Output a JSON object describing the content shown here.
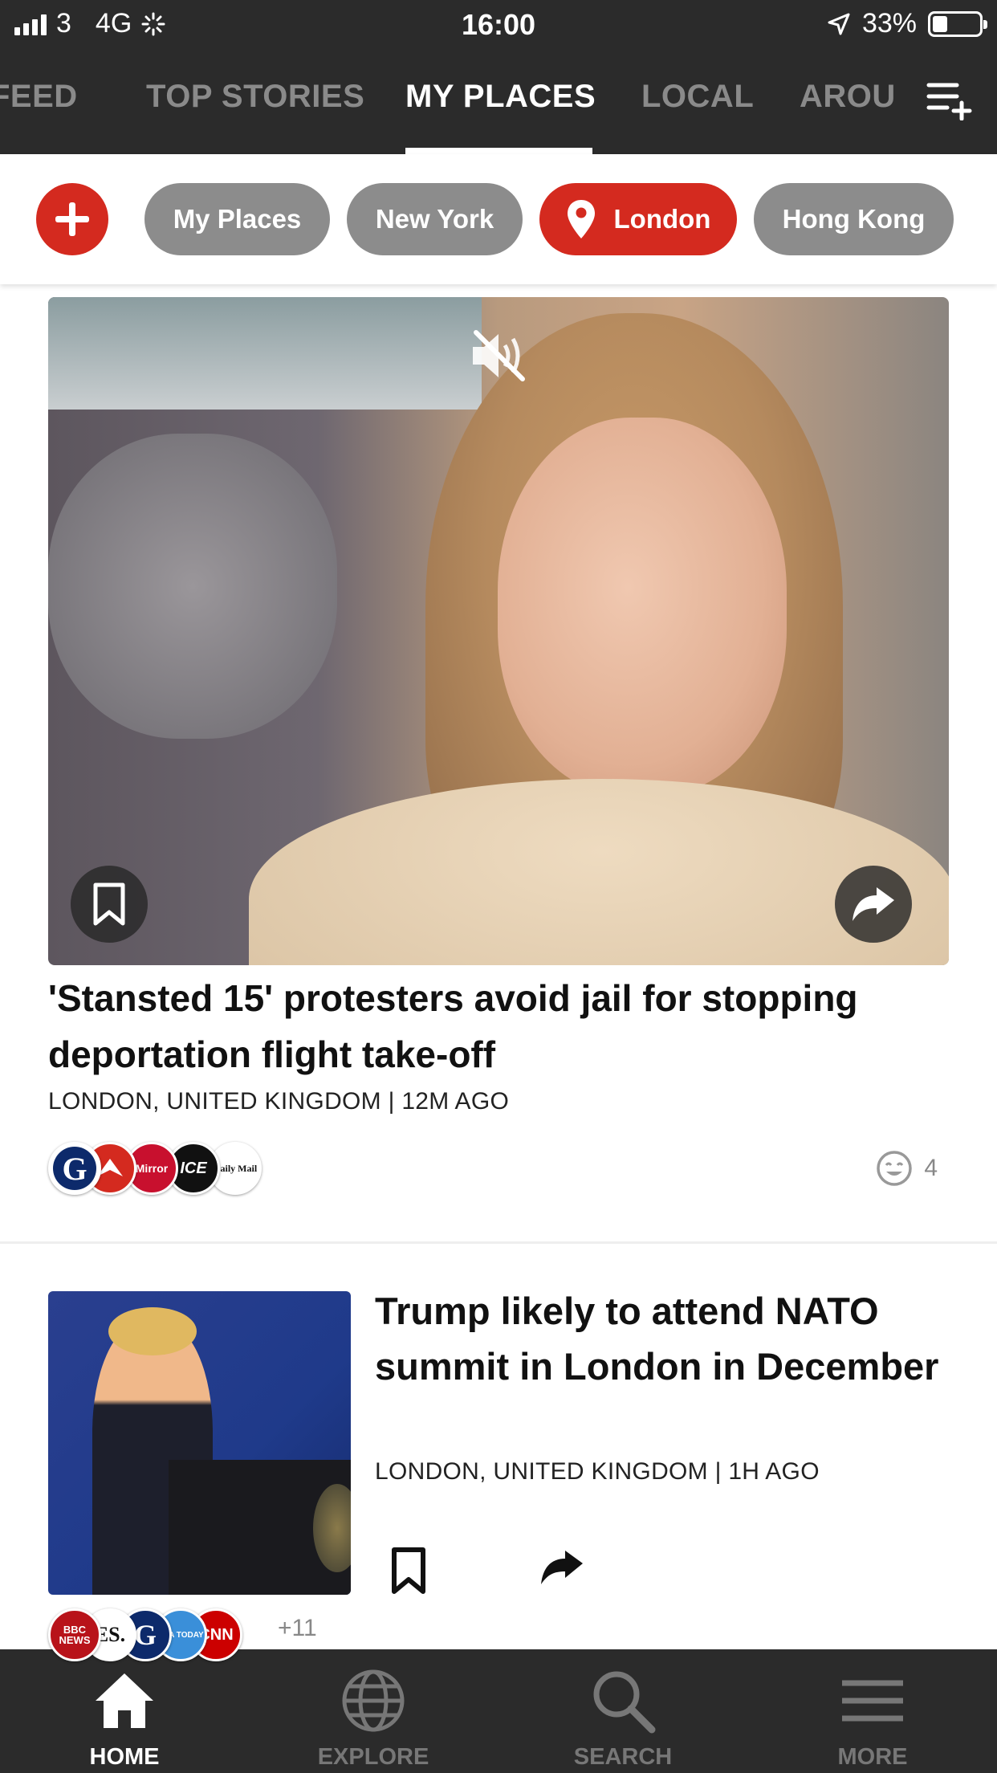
{
  "status_bar": {
    "carrier": "3",
    "network": "4G",
    "time": "16:00",
    "battery": "33%",
    "battery_level": 0.33
  },
  "tabs": [
    {
      "label": "FEED"
    },
    {
      "label": "TOP STORIES"
    },
    {
      "label": "MY PLACES"
    },
    {
      "label": "LOCAL"
    },
    {
      "label": "AROU"
    }
  ],
  "active_tab": "MY PLACES",
  "places": [
    "My Places",
    "New York",
    "London",
    "Hong Kong"
  ],
  "active_place": "London",
  "articles": [
    {
      "headline": "'Stansted 15' protesters avoid jail for stopping deportation flight take-off",
      "meta": "LONDON, UNITED KINGDOM | 12M AGO",
      "publishers": [
        "G",
        "Mirror",
        "ICE",
        "Daily Mail"
      ],
      "reactions": "4"
    },
    {
      "headline": "Trump likely to attend NATO summit in London in December",
      "meta": "LONDON, UNITED KINGDOM | 1H AGO",
      "publishers": [
        "BBC NEWS",
        "ES.",
        "G",
        "USA TODAY",
        "CNN"
      ],
      "more_sources": "+11"
    }
  ],
  "bottom_nav": [
    {
      "label": "HOME",
      "icon": "home-icon"
    },
    {
      "label": "EXPLORE",
      "icon": "globe-icon"
    },
    {
      "label": "SEARCH",
      "icon": "search-icon"
    },
    {
      "label": "MORE",
      "icon": "menu-icon"
    }
  ],
  "colors": {
    "accent": "#d42a1f",
    "bar": "#2b2b2b",
    "chip": "#8c8c8c"
  }
}
